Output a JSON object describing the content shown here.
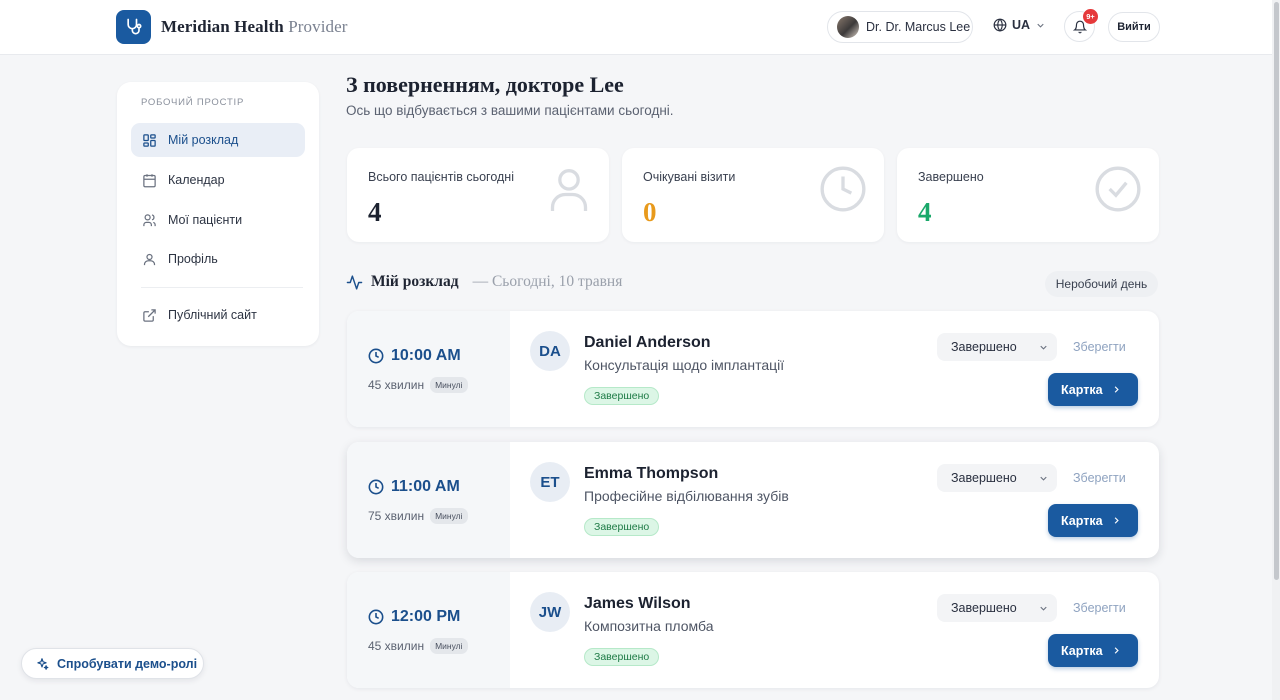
{
  "header": {
    "brand_bold": "Meridian Health",
    "brand_light": "Provider",
    "user_name": "Dr. Dr. Marcus Lee",
    "lang": "UA",
    "notif_count": "9+",
    "logout": "Вийти"
  },
  "sidebar": {
    "heading": "РОБОЧИЙ ПРОСТІР",
    "items": [
      {
        "label": "Мій розклад",
        "icon": "grid-icon",
        "active": true
      },
      {
        "label": "Календар",
        "icon": "calendar-icon"
      },
      {
        "label": "Мої пацієнти",
        "icon": "users-icon"
      },
      {
        "label": "Профіль",
        "icon": "user-icon"
      },
      {
        "label": "Публічний сайт",
        "icon": "external-link-icon"
      }
    ]
  },
  "welcome": {
    "title": "З поверненням, докторе Lee",
    "subtitle": "Ось що відбувається з вашими пацієнтами сьогодні."
  },
  "stats": [
    {
      "label": "Всього пацієнтів сьогодні",
      "value": "4",
      "color": "#1c2230",
      "icon": "person-icon"
    },
    {
      "label": "Очікувані візити",
      "value": "0",
      "color": "#e89a1c",
      "icon": "clock-icon"
    },
    {
      "label": "Завершено",
      "value": "4",
      "color": "#1aa86a",
      "icon": "check-circle-icon"
    }
  ],
  "schedule": {
    "title": "Мій розклад",
    "date": "— Сьогодні, 10 травня",
    "nonwork": "Неробочий день"
  },
  "appointments": [
    {
      "time": "10:00 AM",
      "duration": "45 хвилин",
      "tag": "Минулі",
      "initials": "DA",
      "name": "Daniel Anderson",
      "procedure": "Консультація щодо імплантації",
      "status": "Завершено",
      "select": "Завершено",
      "save": "Зберегти",
      "card": "Картка"
    },
    {
      "time": "11:00 AM",
      "duration": "75 хвилин",
      "tag": "Минулі",
      "initials": "ET",
      "name": "Emma Thompson",
      "procedure": "Професійне відбілювання зубів",
      "status": "Завершено",
      "select": "Завершено",
      "save": "Зберегти",
      "card": "Картка"
    },
    {
      "time": "12:00 PM",
      "duration": "45 хвилин",
      "tag": "Минулі",
      "initials": "JW",
      "name": "James Wilson",
      "procedure": "Композитна пломба",
      "status": "Завершено",
      "select": "Завершено",
      "save": "Зберегти",
      "card": "Картка"
    }
  ],
  "demo_button": "Спробувати демо-ролі",
  "colors": {
    "accent": "#1a5aa0",
    "pending": "#e89a1c",
    "done": "#1aa86a"
  }
}
